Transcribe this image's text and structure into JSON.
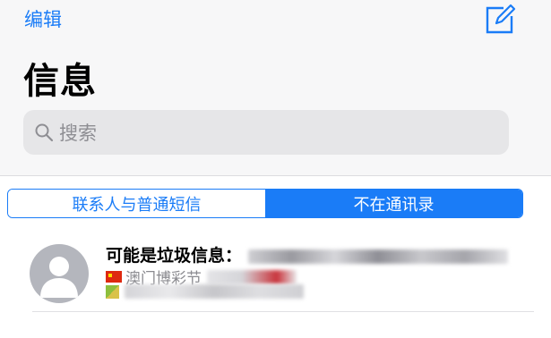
{
  "nav": {
    "edit_label": "编辑",
    "compose_icon": "compose-icon",
    "title": "信息"
  },
  "search": {
    "placeholder": "搜索",
    "icon": "search-icon"
  },
  "filter": {
    "tabs": [
      {
        "label": "联系人与普通短信",
        "selected": false
      },
      {
        "label": "不在通讯录",
        "selected": true
      }
    ]
  },
  "messages": [
    {
      "title": "可能是垃圾信息：",
      "line1": "澳门博彩节",
      "avatar_icon": "person-placeholder-icon"
    }
  ],
  "colors": {
    "accent": "#1a7cf7",
    "background": "#f7f7f8",
    "search_bg": "#e6e6e8"
  }
}
